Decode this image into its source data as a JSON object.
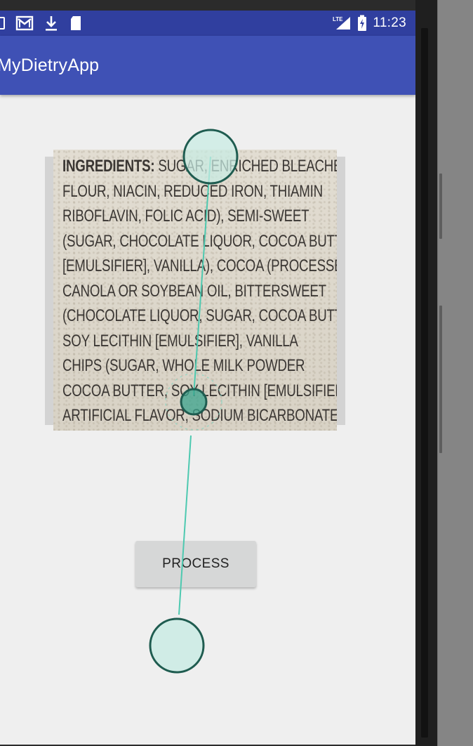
{
  "status_bar": {
    "time": "11:23",
    "notification_icons": [
      "image-icon",
      "gmail-icon",
      "download-icon",
      "sd-card-icon"
    ],
    "system_icons": [
      "lte-signal-icon",
      "battery-charging-icon"
    ],
    "network_label": "LTE"
  },
  "app_bar": {
    "title": "MyDietryApp"
  },
  "ingredients_image": {
    "lines": [
      {
        "head": "INGREDIENTS:",
        "text": " SUGAR, ENRICHED BLEACHED WHEAT"
      },
      {
        "head": "",
        "text": "FLOUR, NIACIN, REDUCED IRON, THIAMIN"
      },
      {
        "head": "",
        "text": "RIBOFLAVIN, FOLIC ACID), SEMI-SWEET"
      },
      {
        "head": "",
        "text": "(SUGAR, CHOCOLATE LIQUOR, COCOA BUTTER"
      },
      {
        "head": "",
        "text": "[EMULSIFIER], VANILLA), COCOA (PROCESSED"
      },
      {
        "head": "",
        "text": "CANOLA OR SOYBEAN OIL, BITTERSWEET"
      },
      {
        "head": "",
        "text": "(CHOCOLATE LIQUOR, SUGAR, COCOA BUTTER"
      },
      {
        "head": "",
        "text": "SOY LECITHIN [EMULSIFIER], VANILLA"
      },
      {
        "head": "",
        "text": "CHIPS (SUGAR, WHOLE MILK POWDER"
      },
      {
        "head": "",
        "text": "COCOA BUTTER, SOY LECITHIN [EMULSIFIER]"
      },
      {
        "head": "",
        "text": "ARTIFICIAL FLAVOR, SODIUM BICARBONATE"
      }
    ]
  },
  "actions": {
    "process_label": "PROCESS"
  },
  "colors": {
    "status_bar": "#303f9f",
    "app_bar": "#3f51b5",
    "screen_background": "#efefef",
    "button": "#d6d7d7",
    "touch_fill": "#c8ebe3",
    "touch_stroke": "#1f5c50",
    "touch_trail": "#4ec9b0"
  }
}
